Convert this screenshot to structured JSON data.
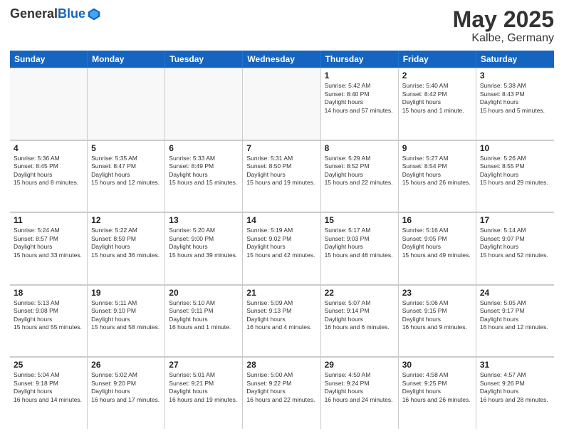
{
  "header": {
    "logo_general": "General",
    "logo_blue": "Blue",
    "month": "May 2025",
    "location": "Kalbe, Germany"
  },
  "days_of_week": [
    "Sunday",
    "Monday",
    "Tuesday",
    "Wednesday",
    "Thursday",
    "Friday",
    "Saturday"
  ],
  "weeks": [
    [
      {
        "day": "",
        "empty": true
      },
      {
        "day": "",
        "empty": true
      },
      {
        "day": "",
        "empty": true
      },
      {
        "day": "",
        "empty": true
      },
      {
        "day": "1",
        "sunrise": "5:42 AM",
        "sunset": "8:40 PM",
        "daylight": "14 hours and 57 minutes."
      },
      {
        "day": "2",
        "sunrise": "5:40 AM",
        "sunset": "8:42 PM",
        "daylight": "15 hours and 1 minute."
      },
      {
        "day": "3",
        "sunrise": "5:38 AM",
        "sunset": "8:43 PM",
        "daylight": "15 hours and 5 minutes."
      }
    ],
    [
      {
        "day": "4",
        "sunrise": "5:36 AM",
        "sunset": "8:45 PM",
        "daylight": "15 hours and 8 minutes."
      },
      {
        "day": "5",
        "sunrise": "5:35 AM",
        "sunset": "8:47 PM",
        "daylight": "15 hours and 12 minutes."
      },
      {
        "day": "6",
        "sunrise": "5:33 AM",
        "sunset": "8:49 PM",
        "daylight": "15 hours and 15 minutes."
      },
      {
        "day": "7",
        "sunrise": "5:31 AM",
        "sunset": "8:50 PM",
        "daylight": "15 hours and 19 minutes."
      },
      {
        "day": "8",
        "sunrise": "5:29 AM",
        "sunset": "8:52 PM",
        "daylight": "15 hours and 22 minutes."
      },
      {
        "day": "9",
        "sunrise": "5:27 AM",
        "sunset": "8:54 PM",
        "daylight": "15 hours and 26 minutes."
      },
      {
        "day": "10",
        "sunrise": "5:26 AM",
        "sunset": "8:55 PM",
        "daylight": "15 hours and 29 minutes."
      }
    ],
    [
      {
        "day": "11",
        "sunrise": "5:24 AM",
        "sunset": "8:57 PM",
        "daylight": "15 hours and 33 minutes."
      },
      {
        "day": "12",
        "sunrise": "5:22 AM",
        "sunset": "8:59 PM",
        "daylight": "15 hours and 36 minutes."
      },
      {
        "day": "13",
        "sunrise": "5:20 AM",
        "sunset": "9:00 PM",
        "daylight": "15 hours and 39 minutes."
      },
      {
        "day": "14",
        "sunrise": "5:19 AM",
        "sunset": "9:02 PM",
        "daylight": "15 hours and 42 minutes."
      },
      {
        "day": "15",
        "sunrise": "5:17 AM",
        "sunset": "9:03 PM",
        "daylight": "15 hours and 46 minutes."
      },
      {
        "day": "16",
        "sunrise": "5:16 AM",
        "sunset": "9:05 PM",
        "daylight": "15 hours and 49 minutes."
      },
      {
        "day": "17",
        "sunrise": "5:14 AM",
        "sunset": "9:07 PM",
        "daylight": "15 hours and 52 minutes."
      }
    ],
    [
      {
        "day": "18",
        "sunrise": "5:13 AM",
        "sunset": "9:08 PM",
        "daylight": "15 hours and 55 minutes."
      },
      {
        "day": "19",
        "sunrise": "5:11 AM",
        "sunset": "9:10 PM",
        "daylight": "15 hours and 58 minutes."
      },
      {
        "day": "20",
        "sunrise": "5:10 AM",
        "sunset": "9:11 PM",
        "daylight": "16 hours and 1 minute."
      },
      {
        "day": "21",
        "sunrise": "5:09 AM",
        "sunset": "9:13 PM",
        "daylight": "16 hours and 4 minutes."
      },
      {
        "day": "22",
        "sunrise": "5:07 AM",
        "sunset": "9:14 PM",
        "daylight": "16 hours and 6 minutes."
      },
      {
        "day": "23",
        "sunrise": "5:06 AM",
        "sunset": "9:15 PM",
        "daylight": "16 hours and 9 minutes."
      },
      {
        "day": "24",
        "sunrise": "5:05 AM",
        "sunset": "9:17 PM",
        "daylight": "16 hours and 12 minutes."
      }
    ],
    [
      {
        "day": "25",
        "sunrise": "5:04 AM",
        "sunset": "9:18 PM",
        "daylight": "16 hours and 14 minutes."
      },
      {
        "day": "26",
        "sunrise": "5:02 AM",
        "sunset": "9:20 PM",
        "daylight": "16 hours and 17 minutes."
      },
      {
        "day": "27",
        "sunrise": "5:01 AM",
        "sunset": "9:21 PM",
        "daylight": "16 hours and 19 minutes."
      },
      {
        "day": "28",
        "sunrise": "5:00 AM",
        "sunset": "9:22 PM",
        "daylight": "16 hours and 22 minutes."
      },
      {
        "day": "29",
        "sunrise": "4:59 AM",
        "sunset": "9:24 PM",
        "daylight": "16 hours and 24 minutes."
      },
      {
        "day": "30",
        "sunrise": "4:58 AM",
        "sunset": "9:25 PM",
        "daylight": "16 hours and 26 minutes."
      },
      {
        "day": "31",
        "sunrise": "4:57 AM",
        "sunset": "9:26 PM",
        "daylight": "16 hours and 28 minutes."
      }
    ]
  ],
  "labels": {
    "sunrise": "Sunrise:",
    "sunset": "Sunset:",
    "daylight": "Daylight hours"
  }
}
